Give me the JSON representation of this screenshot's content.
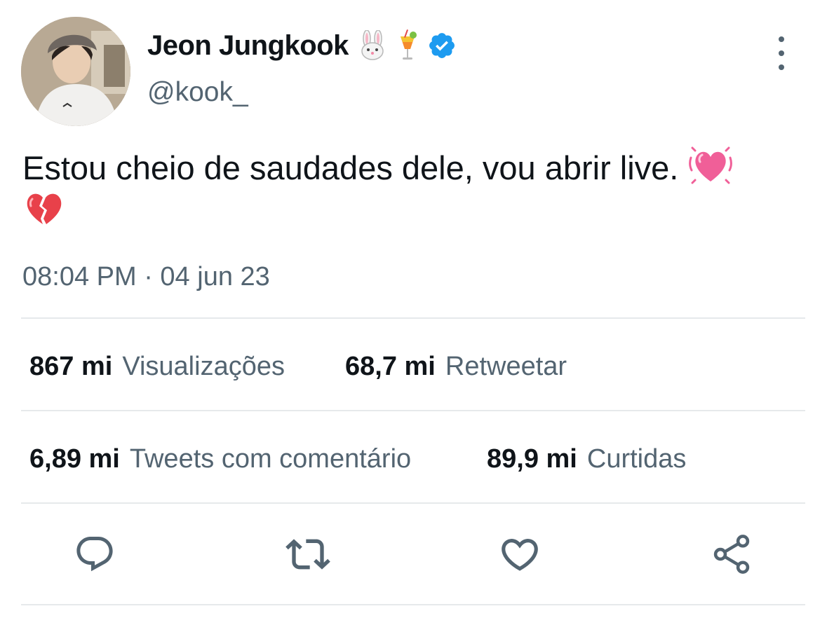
{
  "author": {
    "display_name": "Jeon Jungkook",
    "name_emojis": [
      "rabbit-face",
      "tropical-drink"
    ],
    "verified": true,
    "handle": "@kook_"
  },
  "tweet": {
    "text": "Estou cheio de saudades dele, vou abrir live.",
    "emojis": [
      "beating-heart",
      "broken-heart"
    ],
    "timestamp": "08:04 PM · 04 jun 23"
  },
  "stats": [
    {
      "value": "867 mi",
      "label": "Visualizações"
    },
    {
      "value": "68,7 mi",
      "label": "Retweetar"
    },
    {
      "value": "6,89 mi",
      "label": "Tweets com comentário"
    },
    {
      "value": "89,9 mi",
      "label": "Curtidas"
    }
  ],
  "actions": [
    "reply-icon",
    "retweet-icon",
    "like-icon",
    "share-icon"
  ],
  "colors": {
    "text_primary": "#0f1419",
    "text_secondary": "#536471",
    "verified_blue": "#1d9bf0",
    "divider": "#e6e9eb",
    "pink_heart": "#f05f98",
    "broken_heart": "#e8414a"
  }
}
